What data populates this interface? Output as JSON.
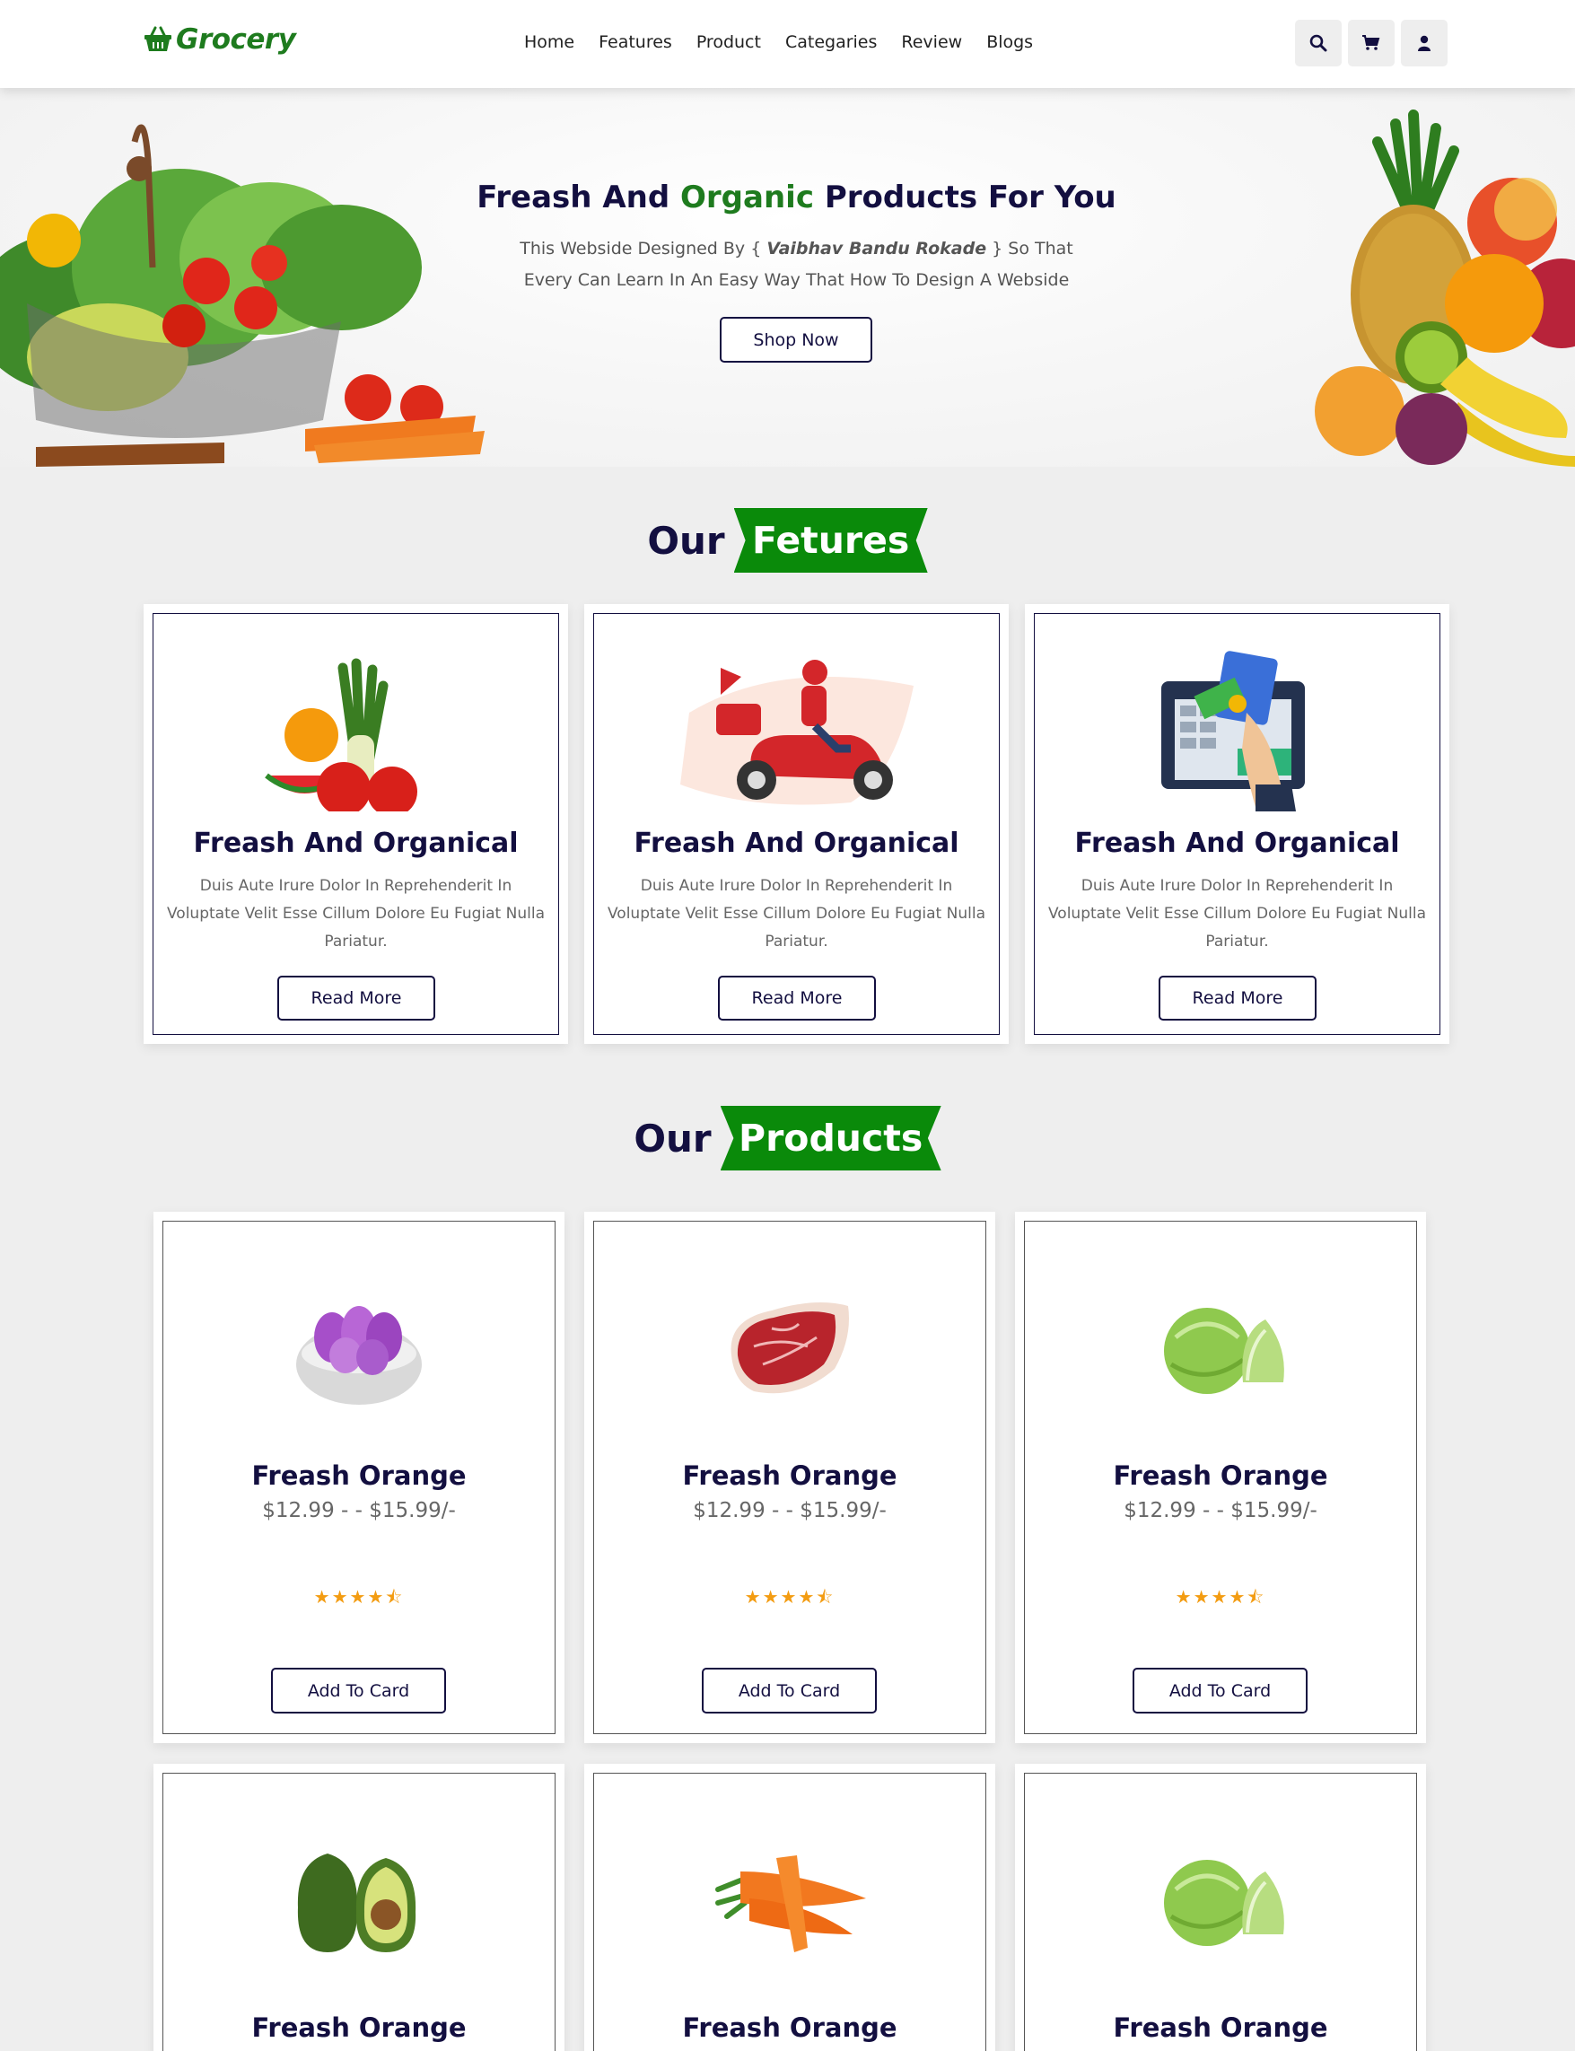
{
  "header": {
    "logo_text": "Grocery",
    "logo_icon": "basket-icon",
    "nav": [
      "Home",
      "Features",
      "Product",
      "Categaries",
      "Review",
      "Blogs"
    ],
    "icons": [
      "search-icon",
      "cart-icon",
      "user-icon"
    ]
  },
  "hero": {
    "title_before": "Freash And ",
    "title_highlight": "Organic",
    "title_after": " Products For You",
    "text_before": "This Webside Designed By { ",
    "text_author": "Vaibhav Bandu Rokade",
    "text_after": " } So That Every Can Learn In An Easy Way That How To Design A Webside",
    "button": "Shop Now"
  },
  "features": {
    "heading_plain": "Our",
    "heading_ribbon": "Fetures",
    "cards": [
      {
        "title": "Freash And Organical",
        "text": "Duis Aute Irure Dolor In Reprehenderit In Voluptate Velit Esse Cillum Dolore Eu Fugiat Nulla Pariatur.",
        "button": "Read More",
        "image": "fresh-produce-illustration"
      },
      {
        "title": "Freash And Organical",
        "text": "Duis Aute Irure Dolor In Reprehenderit In Voluptate Velit Esse Cillum Dolore Eu Fugiat Nulla Pariatur.",
        "button": "Read More",
        "image": "delivery-scooter-illustration"
      },
      {
        "title": "Freash And Organical",
        "text": "Duis Aute Irure Dolor In Reprehenderit In Voluptate Velit Esse Cillum Dolore Eu Fugiat Nulla Pariatur.",
        "button": "Read More",
        "image": "card-payment-illustration"
      }
    ]
  },
  "products": {
    "heading_plain": "Our",
    "heading_ribbon": "Products",
    "items": [
      {
        "name": "Freash Orange",
        "price": "$12.99 - - $15.99/-",
        "rating": 4.5,
        "button": "Add To Card",
        "image": "onion-photo"
      },
      {
        "name": "Freash Orange",
        "price": "$12.99 - - $15.99/-",
        "rating": 4.5,
        "button": "Add To Card",
        "image": "meat-photo"
      },
      {
        "name": "Freash Orange",
        "price": "$12.99 - - $15.99/-",
        "rating": 4.5,
        "button": "Add To Card",
        "image": "cabbage-photo"
      },
      {
        "name": "Freash Orange",
        "image": "avocado-photo"
      },
      {
        "name": "Freash Orange",
        "image": "carrot-photo"
      },
      {
        "name": "Freash Orange",
        "image": "cabbage-photo"
      }
    ]
  },
  "colors": {
    "brand_green": "#1e7b1e",
    "ribbon_green": "#0a8a0a",
    "navy": "#130f40",
    "star": "#f39c12"
  }
}
